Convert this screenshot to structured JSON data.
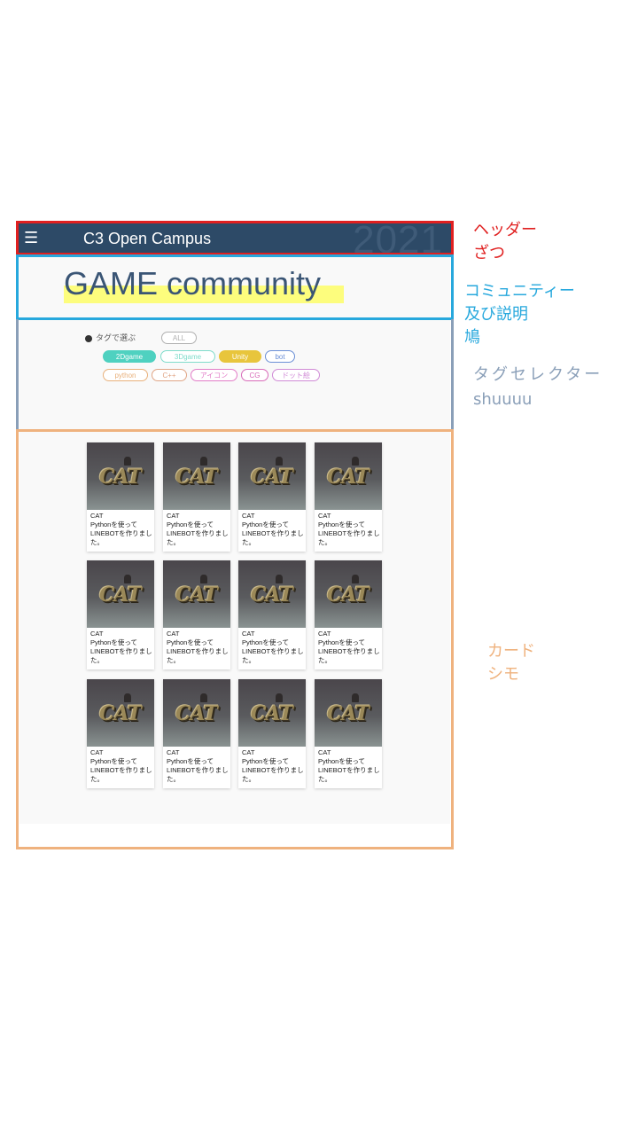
{
  "header": {
    "menu_icon": "☰",
    "title": "C3 Open Campus",
    "year": "2021"
  },
  "community": {
    "title": "GAME community"
  },
  "tag_selector": {
    "heading": "タグで選ぶ",
    "tags": [
      {
        "label": "ALL",
        "style": "outline",
        "color": "#b0b0b0"
      },
      {
        "label": "2Dgame",
        "style": "filled",
        "color": "#4fd1c0"
      },
      {
        "label": "3Dgame",
        "style": "outline",
        "color": "#7fdccb"
      },
      {
        "label": "Unity",
        "style": "filled",
        "color": "#e8c53c"
      },
      {
        "label": "bot",
        "style": "outline",
        "color": "#6b8fd6"
      },
      {
        "label": "python",
        "style": "outline",
        "color": "#e8b07a"
      },
      {
        "label": "C++",
        "style": "outline",
        "color": "#e0a585"
      },
      {
        "label": "アイコン",
        "style": "outline",
        "color": "#e27cc7"
      },
      {
        "label": "CG",
        "style": "outline",
        "color": "#d86ab9"
      },
      {
        "label": "ドット絵",
        "style": "outline",
        "color": "#d08ad6"
      }
    ]
  },
  "cards": [
    {
      "title": "CAT",
      "desc": "Pythonを使ってLINEBOTを作りました。"
    },
    {
      "title": "CAT",
      "desc": "Pythonを使ってLINEBOTを作りました。"
    },
    {
      "title": "CAT",
      "desc": "Pythonを使ってLINEBOTを作りました。"
    },
    {
      "title": "CAT",
      "desc": "Pythonを使ってLINEBOTを作りました。"
    },
    {
      "title": "CAT",
      "desc": "Pythonを使ってLINEBOTを作りました。"
    },
    {
      "title": "CAT",
      "desc": "Pythonを使ってLINEBOTを作りました。"
    },
    {
      "title": "CAT",
      "desc": "Pythonを使ってLINEBOTを作りました。"
    },
    {
      "title": "CAT",
      "desc": "Pythonを使ってLINEBOTを作りました。"
    },
    {
      "title": "CAT",
      "desc": "Pythonを使ってLINEBOTを作りました。"
    },
    {
      "title": "CAT",
      "desc": "Pythonを使ってLINEBOTを作りました。"
    },
    {
      "title": "CAT",
      "desc": "Pythonを使ってLINEBOTを作りました。"
    },
    {
      "title": "CAT",
      "desc": "Pythonを使ってLINEBOTを作りました。"
    }
  ],
  "thumbnail_text": "CAT",
  "annotations": {
    "header": {
      "lines": [
        "ヘッダー",
        "ざつ"
      ],
      "color": "#e02020"
    },
    "community": {
      "lines": [
        "コミュニティー",
        "及び説明",
        "鳩"
      ],
      "color": "#27a8dd"
    },
    "tags": {
      "lines": [
        "タグセレクター",
        "shuuuu"
      ],
      "color": "#8a9fb8"
    },
    "cards": {
      "lines": [
        "カード",
        "シモ"
      ],
      "color": "#efb27e"
    }
  }
}
